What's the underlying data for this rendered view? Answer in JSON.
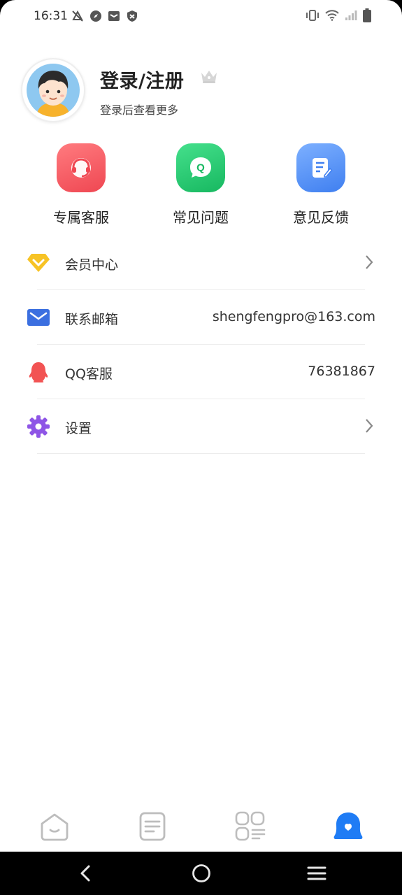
{
  "status_bar": {
    "time": "16:31",
    "left_icons": [
      "notification-off-icon",
      "compass-icon",
      "mail-icon",
      "shield-icon"
    ],
    "right_icons": [
      "vibrate-icon",
      "wifi-icon",
      "signal-icon",
      "battery-icon"
    ]
  },
  "profile": {
    "title": "登录/注册",
    "subtitle": "登录后查看更多"
  },
  "quick_actions": [
    {
      "label": "专属客服",
      "icon": "headset-icon",
      "color": "#f2545b"
    },
    {
      "label": "常见问题",
      "icon": "faq-icon",
      "color": "#22c36b"
    },
    {
      "label": "意见反馈",
      "icon": "feedback-icon",
      "color": "#4a8af4"
    }
  ],
  "menu": [
    {
      "label": "会员中心",
      "icon": "diamond-icon",
      "value": "",
      "color": "#f7c325"
    },
    {
      "label": "联系邮箱",
      "icon": "email-icon",
      "value": "shengfengpro@163.com",
      "color": "#3b6fe0"
    },
    {
      "label": "QQ客服",
      "icon": "qq-penguin-icon",
      "value": "76381867",
      "color": "#f25353"
    },
    {
      "label": "设置",
      "icon": "settings-gear-icon",
      "value": "",
      "color": "#8e55e6"
    }
  ],
  "tabbar": {
    "tabs": [
      "home-icon",
      "notes-icon",
      "apps-icon",
      "profile-icon"
    ],
    "active_index": 3,
    "active_color": "#1f7cf5",
    "inactive_color": "#bdbdbd"
  },
  "nav": [
    "back-icon",
    "home-circle-icon",
    "menu-icon"
  ]
}
